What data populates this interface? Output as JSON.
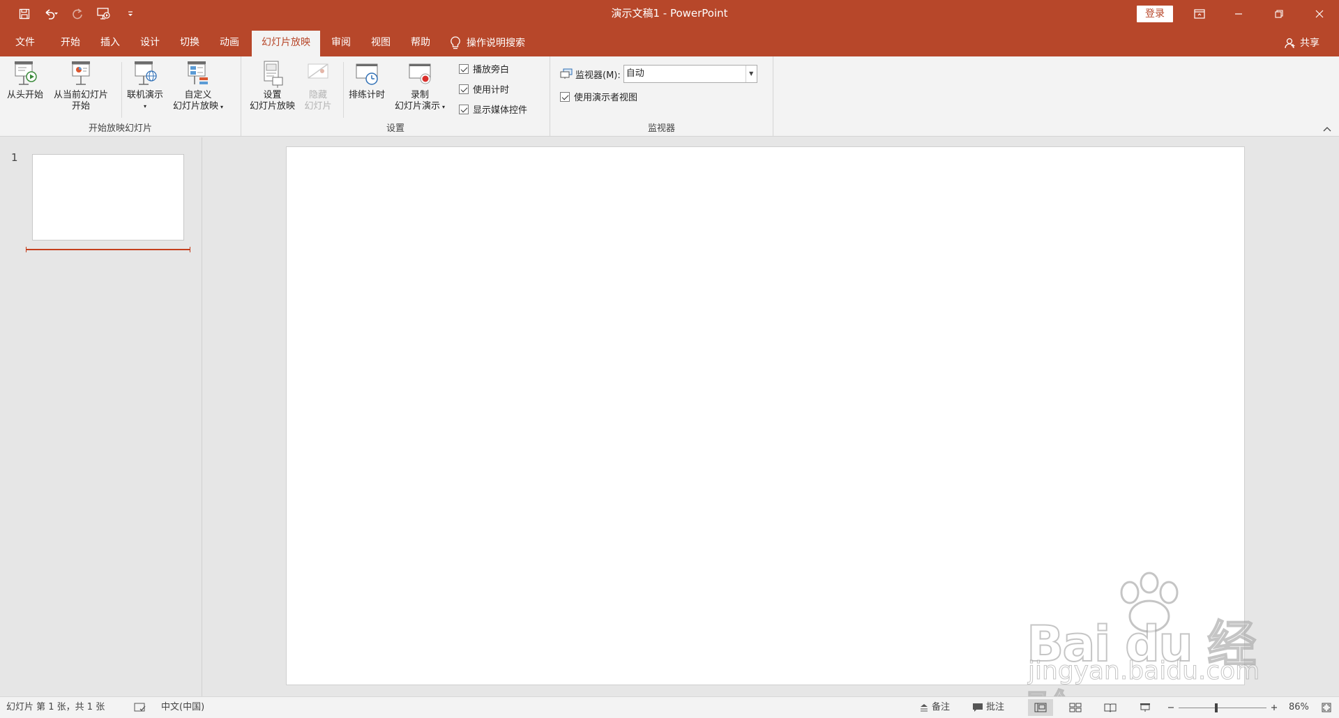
{
  "titlebar": {
    "title": "演示文稿1  -  PowerPoint",
    "login_label": "登录"
  },
  "qat": {
    "items": [
      "save-icon",
      "undo-icon",
      "redo-icon",
      "present-from-start-icon",
      "customize-icon"
    ]
  },
  "tabs": [
    {
      "label": "文件"
    },
    {
      "label": "开始"
    },
    {
      "label": "插入"
    },
    {
      "label": "设计"
    },
    {
      "label": "切换"
    },
    {
      "label": "动画"
    },
    {
      "label": "幻灯片放映",
      "active": true
    },
    {
      "label": "审阅"
    },
    {
      "label": "视图"
    },
    {
      "label": "帮助"
    }
  ],
  "tell_me": "操作说明搜索",
  "share": "共享",
  "ribbon": {
    "group_start": {
      "label": "开始放映幻灯片",
      "from_beginning": "从头开始",
      "from_current_line1": "从当前幻灯片",
      "from_current_line2": "开始",
      "online": "联机演示",
      "custom_line1": "自定义",
      "custom_line2": "幻灯片放映"
    },
    "group_setup": {
      "label": "设置",
      "setup_line1": "设置",
      "setup_line2": "幻灯片放映",
      "hide_line1": "隐藏",
      "hide_line2": "幻灯片",
      "rehearse": "排练计时",
      "record_line1": "录制",
      "record_line2": "幻灯片演示",
      "play_narrations": "播放旁白",
      "use_timings": "使用计时",
      "show_media_controls": "显示媒体控件"
    },
    "group_monitors": {
      "label": "监视器",
      "monitor_label": "监视器(M):",
      "monitor_value": "自动",
      "presenter_view": "使用演示者视图"
    }
  },
  "thumbnails": [
    {
      "number": "1"
    }
  ],
  "watermark": {
    "main": "Bai du 经验",
    "sub": "jingyan.baidu.com"
  },
  "status": {
    "slide_info": "幻灯片 第 1 张，共 1 张",
    "language": "中文(中国)",
    "notes": "备注",
    "comments": "批注",
    "zoom": "86%",
    "zoom_level": 0.43
  }
}
